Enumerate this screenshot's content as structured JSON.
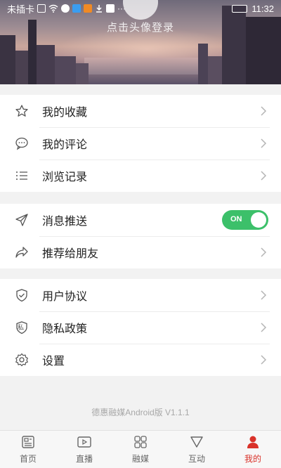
{
  "status_bar": {
    "carrier": "未插卡",
    "time": "11:32"
  },
  "header": {
    "login_prompt": "点击头像登录"
  },
  "menu": {
    "group1": [
      {
        "label": "我的收藏",
        "icon": "star-icon"
      },
      {
        "label": "我的评论",
        "icon": "comment-icon"
      },
      {
        "label": "浏览记录",
        "icon": "list-icon"
      }
    ],
    "group2": [
      {
        "label": "消息推送",
        "icon": "send-icon",
        "toggle": "ON"
      },
      {
        "label": "推荐给朋友",
        "icon": "share-icon"
      }
    ],
    "group3": [
      {
        "label": "用户协议",
        "icon": "shield-check-icon"
      },
      {
        "label": "隐私政策",
        "icon": "privacy-shield-icon",
        "icon_text": "私"
      },
      {
        "label": "设置",
        "icon": "gear-icon"
      }
    ]
  },
  "version": "德惠融媒Android版 V1.1.1",
  "tabs": [
    {
      "label": "首页",
      "icon": "home-icon"
    },
    {
      "label": "直播",
      "icon": "live-icon"
    },
    {
      "label": "融媒",
      "icon": "grid-icon"
    },
    {
      "label": "互动",
      "icon": "interact-icon"
    },
    {
      "label": "我的",
      "icon": "user-icon",
      "active": true
    }
  ],
  "colors": {
    "accent_red": "#d9322a",
    "toggle_green": "#3cc06a"
  }
}
